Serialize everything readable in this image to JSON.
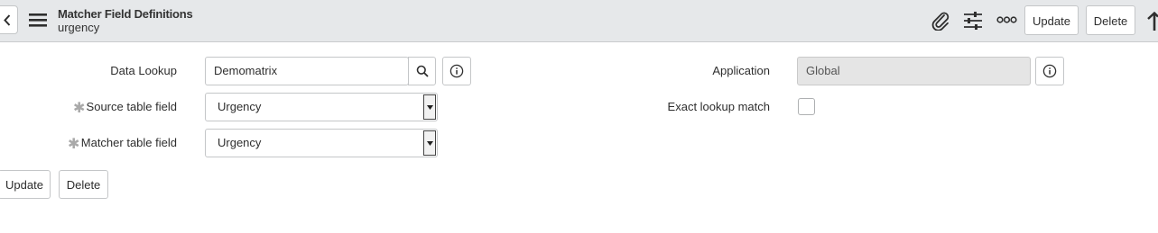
{
  "header": {
    "title": "Matcher Field Definitions",
    "subtitle": "urgency",
    "icons": [
      "back-icon",
      "hamburger-menu-icon",
      "paperclip-icon",
      "sliders-icon",
      "more-options-icon",
      "arrow-up-icon"
    ],
    "update_label": "Update",
    "delete_label": "Delete"
  },
  "form": {
    "data_lookup": {
      "label": "Data Lookup",
      "value": "Demomatrix"
    },
    "source_table_field": {
      "label": "Source table field",
      "value": "Urgency",
      "mandatory_mark": "✱"
    },
    "matcher_table_field": {
      "label": "Matcher table field",
      "value": "Urgency",
      "mandatory_mark": "✱"
    },
    "application": {
      "label": "Application",
      "value": "Global"
    },
    "exact_lookup_match": {
      "label": "Exact lookup match",
      "checked": false
    }
  },
  "footer": {
    "update_label": "Update",
    "delete_label": "Delete"
  },
  "colors": {
    "header_bg": "#e6e8ea",
    "readonly_bg": "#e5e5e5",
    "border": "#c4c6c8",
    "mandatory": "#a9a9a9"
  }
}
